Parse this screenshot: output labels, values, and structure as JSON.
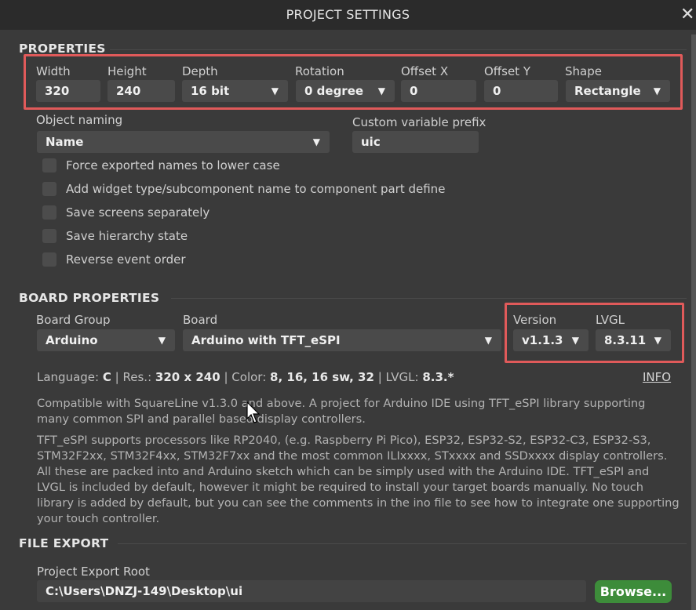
{
  "window": {
    "title": "PROJECT SETTINGS",
    "close_glyph": "✕"
  },
  "properties": {
    "heading": "PROPERTIES",
    "width_label": "Width",
    "width_value": "320",
    "height_label": "Height",
    "height_value": "240",
    "depth_label": "Depth",
    "depth_value": "16 bit",
    "rotation_label": "Rotation",
    "rotation_value": "0 degree",
    "offset_x_label": "Offset X",
    "offset_x_value": "0",
    "offset_y_label": "Offset Y",
    "offset_y_value": "0",
    "shape_label": "Shape",
    "shape_value": "Rectangle",
    "object_naming_label": "Object naming",
    "object_naming_value": "Name",
    "prefix_label": "Custom variable prefix",
    "prefix_value": "uic",
    "checkboxes": [
      {
        "label": "Force exported names to lower case",
        "checked": false
      },
      {
        "label": "Add widget type/subcomponent name to component part define",
        "checked": false
      },
      {
        "label": "Save screens separately",
        "checked": false
      },
      {
        "label": "Save hierarchy state",
        "checked": false
      },
      {
        "label": "Reverse event order",
        "checked": false
      }
    ]
  },
  "board": {
    "heading": "BOARD PROPERTIES",
    "group_label": "Board Group",
    "group_value": "Arduino",
    "board_label": "Board",
    "board_value": "Arduino with TFT_eSPI",
    "version_label": "Version",
    "version_value": "v1.1.3",
    "lvgl_label": "LVGL",
    "lvgl_value": "8.3.11",
    "info": {
      "language_key": "Language:",
      "language_val": "C",
      "res_key": "Res.:",
      "res_val": "320 x 240",
      "color_key": "Color:",
      "color_val": "8, 16, 16 sw, 32",
      "lvgl_key": "LVGL:",
      "lvgl_val": "8.3.*",
      "sep": "|",
      "link": "INFO"
    },
    "desc1": "Compatible with SquareLine v1.3.0 and above. A project for Arduino IDE using TFT_eSPI library supporting many common SPI and parallel based display controllers.",
    "desc2": "TFT_eSPI supports processors like RP2040, (e.g. Raspberry Pi Pico), ESP32, ESP32-S2, ESP32-C3, ESP32-S3, STM32F2xx, STM32F4xx, STM32F7xx and the most common ILIxxxx, STxxxx and SSDxxxx display controllers. All these are packed into and Arduino sketch which can be simply used with the Arduino IDE. TFT_eSPI and LVGL is included by default, however it might be required to install your target boards manually.  No touch library is added by default, but you can see the comments in the ino file to see how to integrate one supporting your touch controller."
  },
  "export": {
    "heading": "FILE EXPORT",
    "root_label": "Project Export Root",
    "root_value": "C:\\Users\\DNZJ-149\\Desktop\\ui",
    "browse_label": "Browse..."
  },
  "icons": {
    "dropdown": "▼",
    "close": "close-icon",
    "cursor": "mouse-pointer-icon"
  },
  "colors": {
    "highlight": "#e05a5a",
    "browse": "#3d8c3a",
    "background": "#3a3a3a"
  }
}
